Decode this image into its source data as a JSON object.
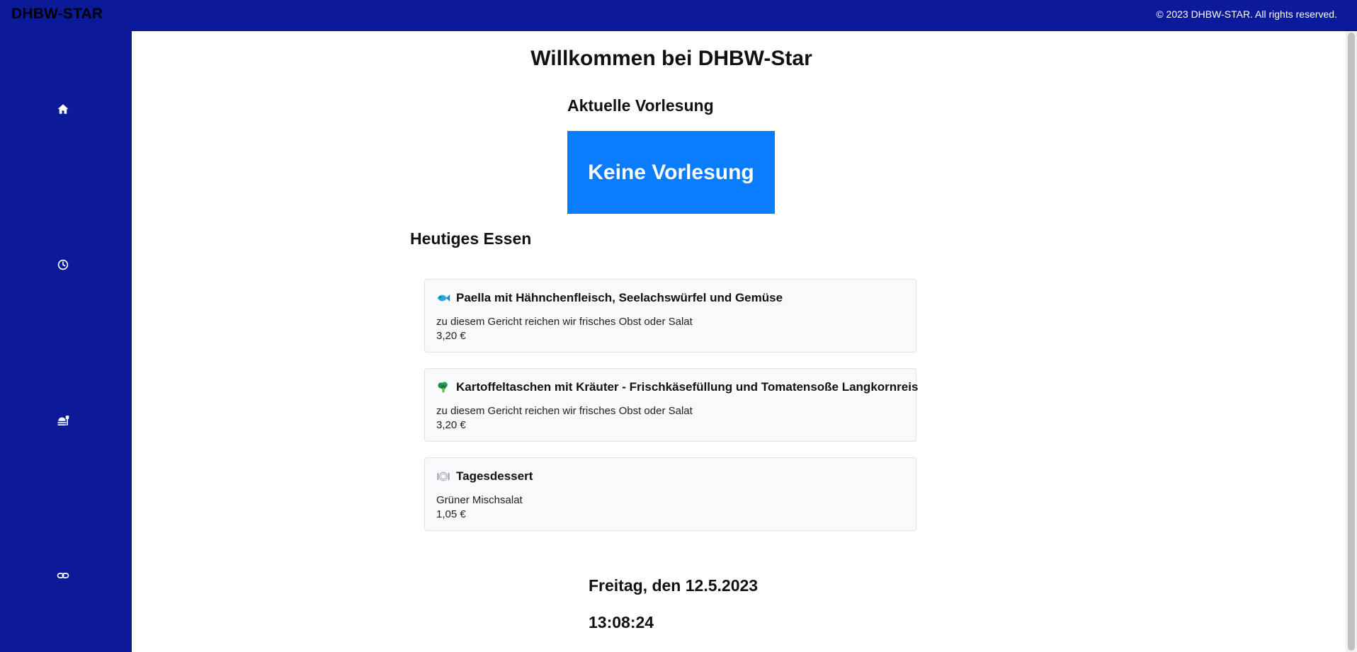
{
  "header": {
    "brand": "DHBW-STAR",
    "copyright": "© 2023 DHBW-STAR. All rights reserved."
  },
  "sidebar": {
    "items": [
      {
        "icon": "home-icon"
      },
      {
        "icon": "clock-icon"
      },
      {
        "icon": "food-icon"
      },
      {
        "icon": "link-icon"
      }
    ]
  },
  "main": {
    "title": "Willkommen bei DHBW-Star",
    "lecture": {
      "heading": "Aktuelle Vorlesung",
      "current": "Keine Vorlesung"
    },
    "food": {
      "heading": "Heutiges Essen",
      "meals": [
        {
          "icon": "fish-icon",
          "name": "Paella mit Hähnchenfleisch, Seelachswürfel und Gemüse",
          "description": "zu diesem Gericht reichen wir frisches Obst oder Salat",
          "price": "3,20 €"
        },
        {
          "icon": "broccoli-icon",
          "name": "Kartoffeltaschen mit Kräuter - Frischkäsefüllung und Tomatensoße Langkornreis",
          "description": "zu diesem Gericht reichen wir frisches Obst oder Salat",
          "price": "3,20 €"
        },
        {
          "icon": "plate-icon",
          "name": "Tagesdessert",
          "description": "Grüner Mischsalat",
          "price": "1,05 €"
        }
      ]
    },
    "date": "Freitag, den 12.5.2023",
    "time": "13:08:24"
  },
  "colors": {
    "navy": "#0a1a99",
    "accent_blue": "#0a7cff",
    "card_bg": "#f8f9fa"
  }
}
